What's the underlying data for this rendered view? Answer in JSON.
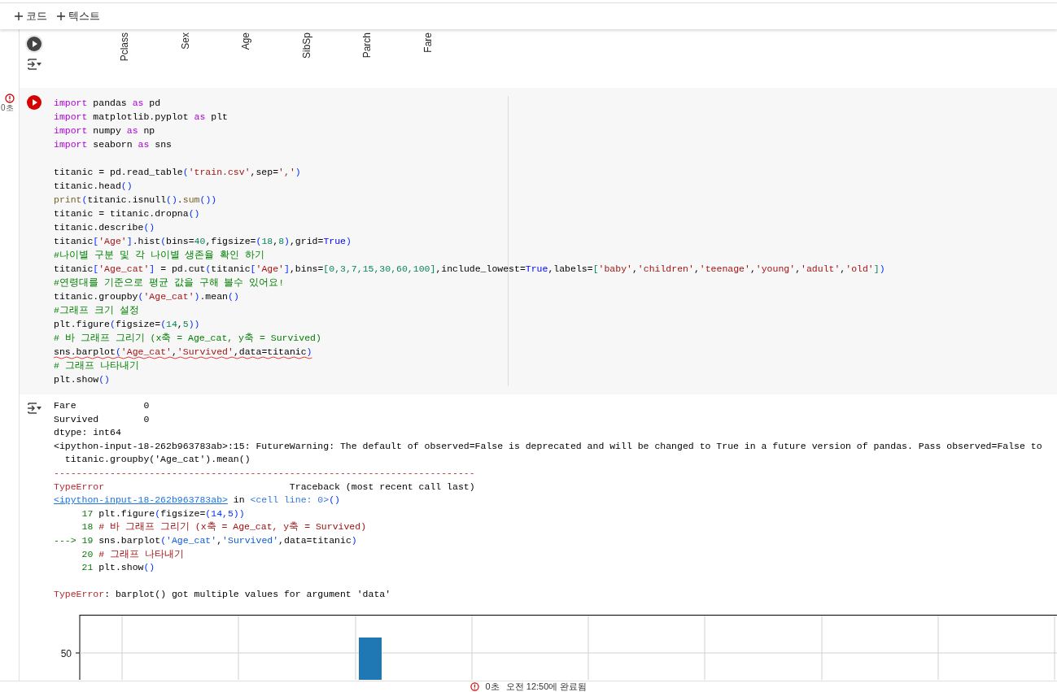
{
  "toolbar": {
    "buttons": [
      {
        "label": "코드"
      },
      {
        "label": "텍스트"
      }
    ]
  },
  "previous_output": {
    "axis_labels": [
      "Pclass",
      "Sex",
      "Age",
      "SibSp",
      "Parch",
      "Fare"
    ]
  },
  "cell": {
    "failed": true,
    "elapsed": "0초",
    "code_lines": [
      {
        "kind": "code",
        "warning": false,
        "tokens": [
          {
            "kind": "kw",
            "text": "import"
          },
          {
            "kind": "p",
            "text": " pandas "
          },
          {
            "kind": "kw",
            "text": "as"
          },
          {
            "kind": "p",
            "text": " pd"
          }
        ]
      },
      {
        "kind": "code",
        "warning": false,
        "tokens": [
          {
            "kind": "kw",
            "text": "import"
          },
          {
            "kind": "p",
            "text": " matplotlib.pyplot "
          },
          {
            "kind": "kw",
            "text": "as"
          },
          {
            "kind": "p",
            "text": " plt"
          }
        ]
      },
      {
        "kind": "code",
        "warning": false,
        "tokens": [
          {
            "kind": "kw",
            "text": "import"
          },
          {
            "kind": "p",
            "text": " numpy "
          },
          {
            "kind": "kw",
            "text": "as"
          },
          {
            "kind": "p",
            "text": " np"
          }
        ]
      },
      {
        "kind": "code",
        "warning": false,
        "tokens": [
          {
            "kind": "kw",
            "text": "import"
          },
          {
            "kind": "p",
            "text": " seaborn "
          },
          {
            "kind": "kw",
            "text": "as"
          },
          {
            "kind": "p",
            "text": " sns"
          }
        ]
      },
      {
        "kind": "blank"
      },
      {
        "kind": "code",
        "warning": false,
        "tokens": [
          {
            "kind": "p",
            "text": "titanic = pd.read_table"
          },
          {
            "kind": "par",
            "text": "("
          },
          {
            "kind": "str",
            "text": "'train.csv'"
          },
          {
            "kind": "p",
            "text": ",sep="
          },
          {
            "kind": "str",
            "text": "','"
          },
          {
            "kind": "par",
            "text": ")"
          }
        ]
      },
      {
        "kind": "code",
        "warning": false,
        "tokens": [
          {
            "kind": "p",
            "text": "titanic.head"
          },
          {
            "kind": "par",
            "text": "()"
          }
        ]
      },
      {
        "kind": "code",
        "warning": false,
        "tokens": [
          {
            "kind": "fn",
            "text": "print"
          },
          {
            "kind": "par",
            "text": "("
          },
          {
            "kind": "p",
            "text": "titanic.isnull"
          },
          {
            "kind": "par",
            "text": "()"
          },
          {
            "kind": "p",
            "text": "."
          },
          {
            "kind": "fn",
            "text": "sum"
          },
          {
            "kind": "par",
            "text": "())"
          }
        ]
      },
      {
        "kind": "code",
        "warning": false,
        "tokens": [
          {
            "kind": "p",
            "text": "titanic = titanic.dropna"
          },
          {
            "kind": "par",
            "text": "()"
          }
        ]
      },
      {
        "kind": "code",
        "warning": false,
        "tokens": [
          {
            "kind": "p",
            "text": "titanic.describe"
          },
          {
            "kind": "par",
            "text": "()"
          }
        ]
      },
      {
        "kind": "code",
        "warning": false,
        "tokens": [
          {
            "kind": "p",
            "text": "titanic"
          },
          {
            "kind": "par",
            "text": "["
          },
          {
            "kind": "str",
            "text": "'Age'"
          },
          {
            "kind": "par",
            "text": "]"
          },
          {
            "kind": "p",
            "text": ".hist"
          },
          {
            "kind": "par",
            "text": "("
          },
          {
            "kind": "p",
            "text": "bins="
          },
          {
            "kind": "num",
            "text": "40"
          },
          {
            "kind": "p",
            "text": ",figsize="
          },
          {
            "kind": "par",
            "text": "("
          },
          {
            "kind": "num",
            "text": "18"
          },
          {
            "kind": "p",
            "text": ","
          },
          {
            "kind": "num",
            "text": "8"
          },
          {
            "kind": "par",
            "text": ")"
          },
          {
            "kind": "p",
            "text": ",grid="
          },
          {
            "kind": "const",
            "text": "True"
          },
          {
            "kind": "par",
            "text": ")"
          }
        ]
      },
      {
        "kind": "code",
        "warning": false,
        "tokens": [
          {
            "kind": "com",
            "text": "#나이별 구분 및 각 나이별 생존율 확인 하기"
          }
        ]
      },
      {
        "kind": "code",
        "warning": false,
        "tokens": [
          {
            "kind": "p",
            "text": "titanic"
          },
          {
            "kind": "par",
            "text": "["
          },
          {
            "kind": "str",
            "text": "'Age_cat'"
          },
          {
            "kind": "par",
            "text": "]"
          },
          {
            "kind": "p",
            "text": " = pd.cut"
          },
          {
            "kind": "par",
            "text": "("
          },
          {
            "kind": "p",
            "text": "titanic"
          },
          {
            "kind": "par",
            "text": "["
          },
          {
            "kind": "str",
            "text": "'Age'"
          },
          {
            "kind": "par",
            "text": "]"
          },
          {
            "kind": "p",
            "text": ",bins="
          },
          {
            "kind": "num",
            "text": "[0,3,7,15,30,60,100]"
          },
          {
            "kind": "p",
            "text": ",include_lowest="
          },
          {
            "kind": "const",
            "text": "True"
          },
          {
            "kind": "p",
            "text": ",labels="
          },
          {
            "kind": "num",
            "text": "["
          },
          {
            "kind": "str",
            "text": "'baby'"
          },
          {
            "kind": "p",
            "text": ","
          },
          {
            "kind": "str",
            "text": "'children'"
          },
          {
            "kind": "p",
            "text": ","
          },
          {
            "kind": "str",
            "text": "'teenage'"
          },
          {
            "kind": "p",
            "text": ","
          },
          {
            "kind": "str",
            "text": "'young'"
          },
          {
            "kind": "p",
            "text": ","
          },
          {
            "kind": "str",
            "text": "'adult'"
          },
          {
            "kind": "p",
            "text": ","
          },
          {
            "kind": "str",
            "text": "'old'"
          },
          {
            "kind": "num",
            "text": "]"
          },
          {
            "kind": "par",
            "text": ")"
          }
        ]
      },
      {
        "kind": "code",
        "warning": false,
        "tokens": [
          {
            "kind": "com",
            "text": "#연령대를 기준으로 평균 값을 구해 볼수 있어요!"
          }
        ]
      },
      {
        "kind": "code",
        "warning": false,
        "tokens": [
          {
            "kind": "p",
            "text": "titanic.groupby"
          },
          {
            "kind": "par",
            "text": "("
          },
          {
            "kind": "str",
            "text": "'Age_cat'"
          },
          {
            "kind": "par",
            "text": ")"
          },
          {
            "kind": "p",
            "text": ".mean"
          },
          {
            "kind": "par",
            "text": "()"
          }
        ]
      },
      {
        "kind": "code",
        "warning": false,
        "tokens": [
          {
            "kind": "com",
            "text": "#그래프 크기 설정"
          }
        ]
      },
      {
        "kind": "code",
        "warning": false,
        "tokens": [
          {
            "kind": "p",
            "text": "plt.figure"
          },
          {
            "kind": "par",
            "text": "("
          },
          {
            "kind": "p",
            "text": "figsize="
          },
          {
            "kind": "par",
            "text": "("
          },
          {
            "kind": "num",
            "text": "14"
          },
          {
            "kind": "p",
            "text": ","
          },
          {
            "kind": "num",
            "text": "5"
          },
          {
            "kind": "par",
            "text": "))"
          }
        ]
      },
      {
        "kind": "code",
        "warning": false,
        "tokens": [
          {
            "kind": "com",
            "text": "# 바 그래프 그리기 (x축 = Age_cat, y축 = Survived)"
          }
        ]
      },
      {
        "kind": "code",
        "warning": true,
        "tokens": [
          {
            "kind": "p",
            "text": "sns.barplot"
          },
          {
            "kind": "par",
            "text": "("
          },
          {
            "kind": "str",
            "text": "'Age_cat'"
          },
          {
            "kind": "p",
            "text": ","
          },
          {
            "kind": "str",
            "text": "'Survived'"
          },
          {
            "kind": "p",
            "text": ",data=titanic"
          },
          {
            "kind": "par",
            "text": ")"
          }
        ]
      },
      {
        "kind": "code",
        "warning": false,
        "tokens": [
          {
            "kind": "com",
            "text": "# 그래프 나타내기"
          }
        ]
      },
      {
        "kind": "code",
        "warning": false,
        "tokens": [
          {
            "kind": "p",
            "text": "plt.show"
          },
          {
            "kind": "par",
            "text": "()"
          }
        ]
      }
    ],
    "output_lines": [
      {
        "kind": "text",
        "tokens": [
          {
            "kind": "p",
            "text": "Fare            0"
          }
        ]
      },
      {
        "kind": "text",
        "tokens": [
          {
            "kind": "p",
            "text": "Survived        0"
          }
        ]
      },
      {
        "kind": "text",
        "tokens": [
          {
            "kind": "p",
            "text": "dtype: int64"
          }
        ]
      },
      {
        "kind": "text",
        "tokens": [
          {
            "kind": "p",
            "text": "<ipython-input-18-262b963783ab>:15: FutureWarning: The default of observed=False is deprecated and will be changed to True in a future version of pandas. Pass observed=False to"
          }
        ]
      },
      {
        "kind": "text",
        "tokens": [
          {
            "kind": "p",
            "text": "  titanic.groupby('Age_cat').mean()"
          }
        ]
      },
      {
        "kind": "text",
        "tokens": [
          {
            "kind": "err",
            "text": "---------------------------------------------------------------------------"
          }
        ]
      },
      {
        "kind": "text",
        "tokens": [
          {
            "kind": "err",
            "text": "TypeError"
          },
          {
            "kind": "p",
            "text": "                                 Traceback (most recent call last)"
          }
        ]
      },
      {
        "kind": "text",
        "tokens": [
          {
            "kind": "link",
            "text": "<ipython-input-18-262b963783ab>"
          },
          {
            "kind": "p",
            "text": " in "
          },
          {
            "kind": "blue",
            "text": "<cell line: 0>"
          },
          {
            "kind": "par",
            "text": "()"
          }
        ]
      },
      {
        "kind": "text",
        "tokens": [
          {
            "kind": "lnum",
            "text": "     17 "
          },
          {
            "kind": "p",
            "text": "plt.figure"
          },
          {
            "kind": "par",
            "text": "("
          },
          {
            "kind": "p",
            "text": "figsize="
          },
          {
            "kind": "par",
            "text": "(14,5))"
          }
        ]
      },
      {
        "kind": "text",
        "tokens": [
          {
            "kind": "lnum",
            "text": "     18 "
          },
          {
            "kind": "tcom",
            "text": "# 바 그래프 그리기 (x축 = Age_cat, y축 = Survived)"
          }
        ]
      },
      {
        "kind": "text",
        "tokens": [
          {
            "kind": "lnum",
            "text": "---> 19 "
          },
          {
            "kind": "p",
            "text": "sns.barplot"
          },
          {
            "kind": "par",
            "text": "("
          },
          {
            "kind": "tstr",
            "text": "'Age_cat'"
          },
          {
            "kind": "p",
            "text": ","
          },
          {
            "kind": "tstr",
            "text": "'Survived'"
          },
          {
            "kind": "p",
            "text": ",data=titanic"
          },
          {
            "kind": "par",
            "text": ")"
          }
        ]
      },
      {
        "kind": "text",
        "tokens": [
          {
            "kind": "lnum",
            "text": "     20 "
          },
          {
            "kind": "tcom",
            "text": "# 그래프 나타내기"
          }
        ]
      },
      {
        "kind": "text",
        "tokens": [
          {
            "kind": "lnum",
            "text": "     21 "
          },
          {
            "kind": "p",
            "text": "plt.show"
          },
          {
            "kind": "par",
            "text": "()"
          }
        ]
      },
      {
        "kind": "blank"
      },
      {
        "kind": "text",
        "tokens": [
          {
            "kind": "err",
            "text": "TypeError"
          },
          {
            "kind": "p",
            "text": ": barplot() got multiple values for argument 'data'"
          }
        ]
      }
    ],
    "chart": {
      "y_tick_label": "50"
    }
  },
  "status_bar": {
    "elapsed": "0초",
    "message": "오전 12:50에 완료됨"
  }
}
